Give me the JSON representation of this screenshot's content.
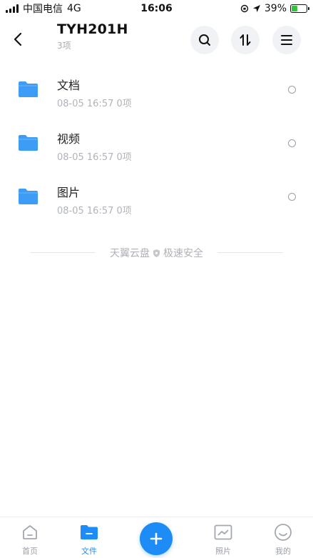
{
  "status_bar": {
    "carrier": "中国电信",
    "network": "4G",
    "time": "16:06",
    "battery_pct": "39%",
    "battery_level": 0.39
  },
  "header": {
    "title": "TYH201H",
    "subtitle": "3项"
  },
  "files": [
    {
      "name": "文档",
      "meta": "08-05 16:57 0项"
    },
    {
      "name": "视频",
      "meta": "08-05 16:57 0项"
    },
    {
      "name": "图片",
      "meta": "08-05 16:57 0项"
    }
  ],
  "brand": {
    "name": "天翼云盘",
    "slogan": "极速安全"
  },
  "nav": {
    "home": "首页",
    "files": "文件",
    "photos": "照片",
    "mine": "我的"
  },
  "colors": {
    "accent": "#1e8cf6",
    "folder": "#3d9cf5",
    "battery": "#36c23a"
  }
}
